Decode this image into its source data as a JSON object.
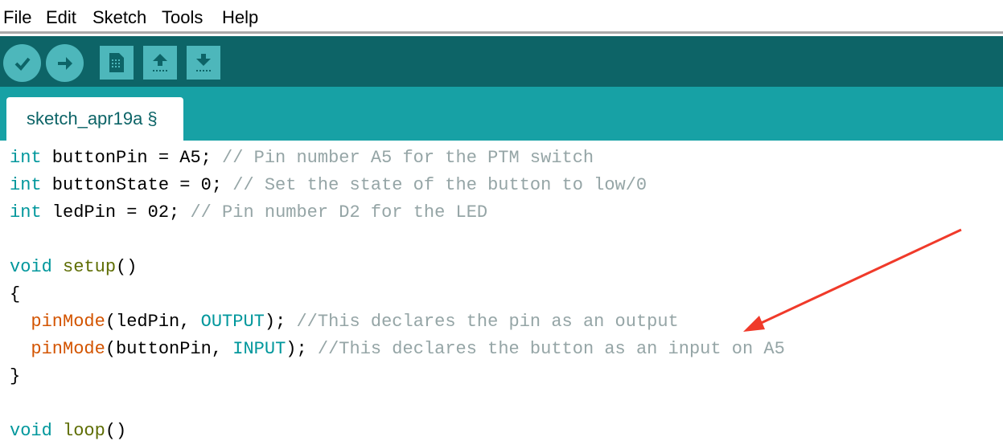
{
  "menu": [
    "File",
    "Edit",
    "Sketch",
    "Tools",
    "Help"
  ],
  "toolbar": {
    "buttons": [
      "verify-icon",
      "upload-icon",
      "new-icon",
      "open-icon",
      "save-icon"
    ],
    "color": "#0d6467",
    "button_color": "#4db7bb"
  },
  "tab": {
    "label": "sketch_apr19a §"
  },
  "code": [
    [
      [
        "kw",
        "int"
      ],
      [
        "pl",
        " buttonPin = A5; "
      ],
      [
        "cm",
        "// Pin number A5 for the PTM switch"
      ]
    ],
    [
      [
        "kw",
        "int"
      ],
      [
        "pl",
        " buttonState = 0; "
      ],
      [
        "cm",
        "// Set the state of the button to low/0"
      ]
    ],
    [
      [
        "kw",
        "int"
      ],
      [
        "pl",
        " ledPin = 02; "
      ],
      [
        "cm",
        "// Pin number D2 for the LED"
      ]
    ],
    [],
    [
      [
        "kw",
        "void"
      ],
      [
        "pl",
        " "
      ],
      [
        "fn2",
        "setup"
      ],
      [
        "pl",
        "()"
      ]
    ],
    [
      [
        "pl",
        "{"
      ]
    ],
    [
      [
        "pl",
        "  "
      ],
      [
        "fn",
        "pinMode"
      ],
      [
        "pl",
        "(ledPin, "
      ],
      [
        "kw",
        "OUTPUT"
      ],
      [
        "pl",
        "); "
      ],
      [
        "cm",
        "//This declares the pin as an output"
      ]
    ],
    [
      [
        "pl",
        "  "
      ],
      [
        "fn",
        "pinMode"
      ],
      [
        "pl",
        "(buttonPin, "
      ],
      [
        "kw",
        "INPUT"
      ],
      [
        "pl",
        "); "
      ],
      [
        "cm",
        "//This declares the button as an input on A5"
      ]
    ],
    [
      [
        "pl",
        "}"
      ]
    ],
    [],
    [
      [
        "kw",
        "void"
      ],
      [
        "pl",
        " "
      ],
      [
        "fn2",
        "loop"
      ],
      [
        "pl",
        "()"
      ]
    ]
  ],
  "annotation": {
    "color": "#f03a2a"
  }
}
